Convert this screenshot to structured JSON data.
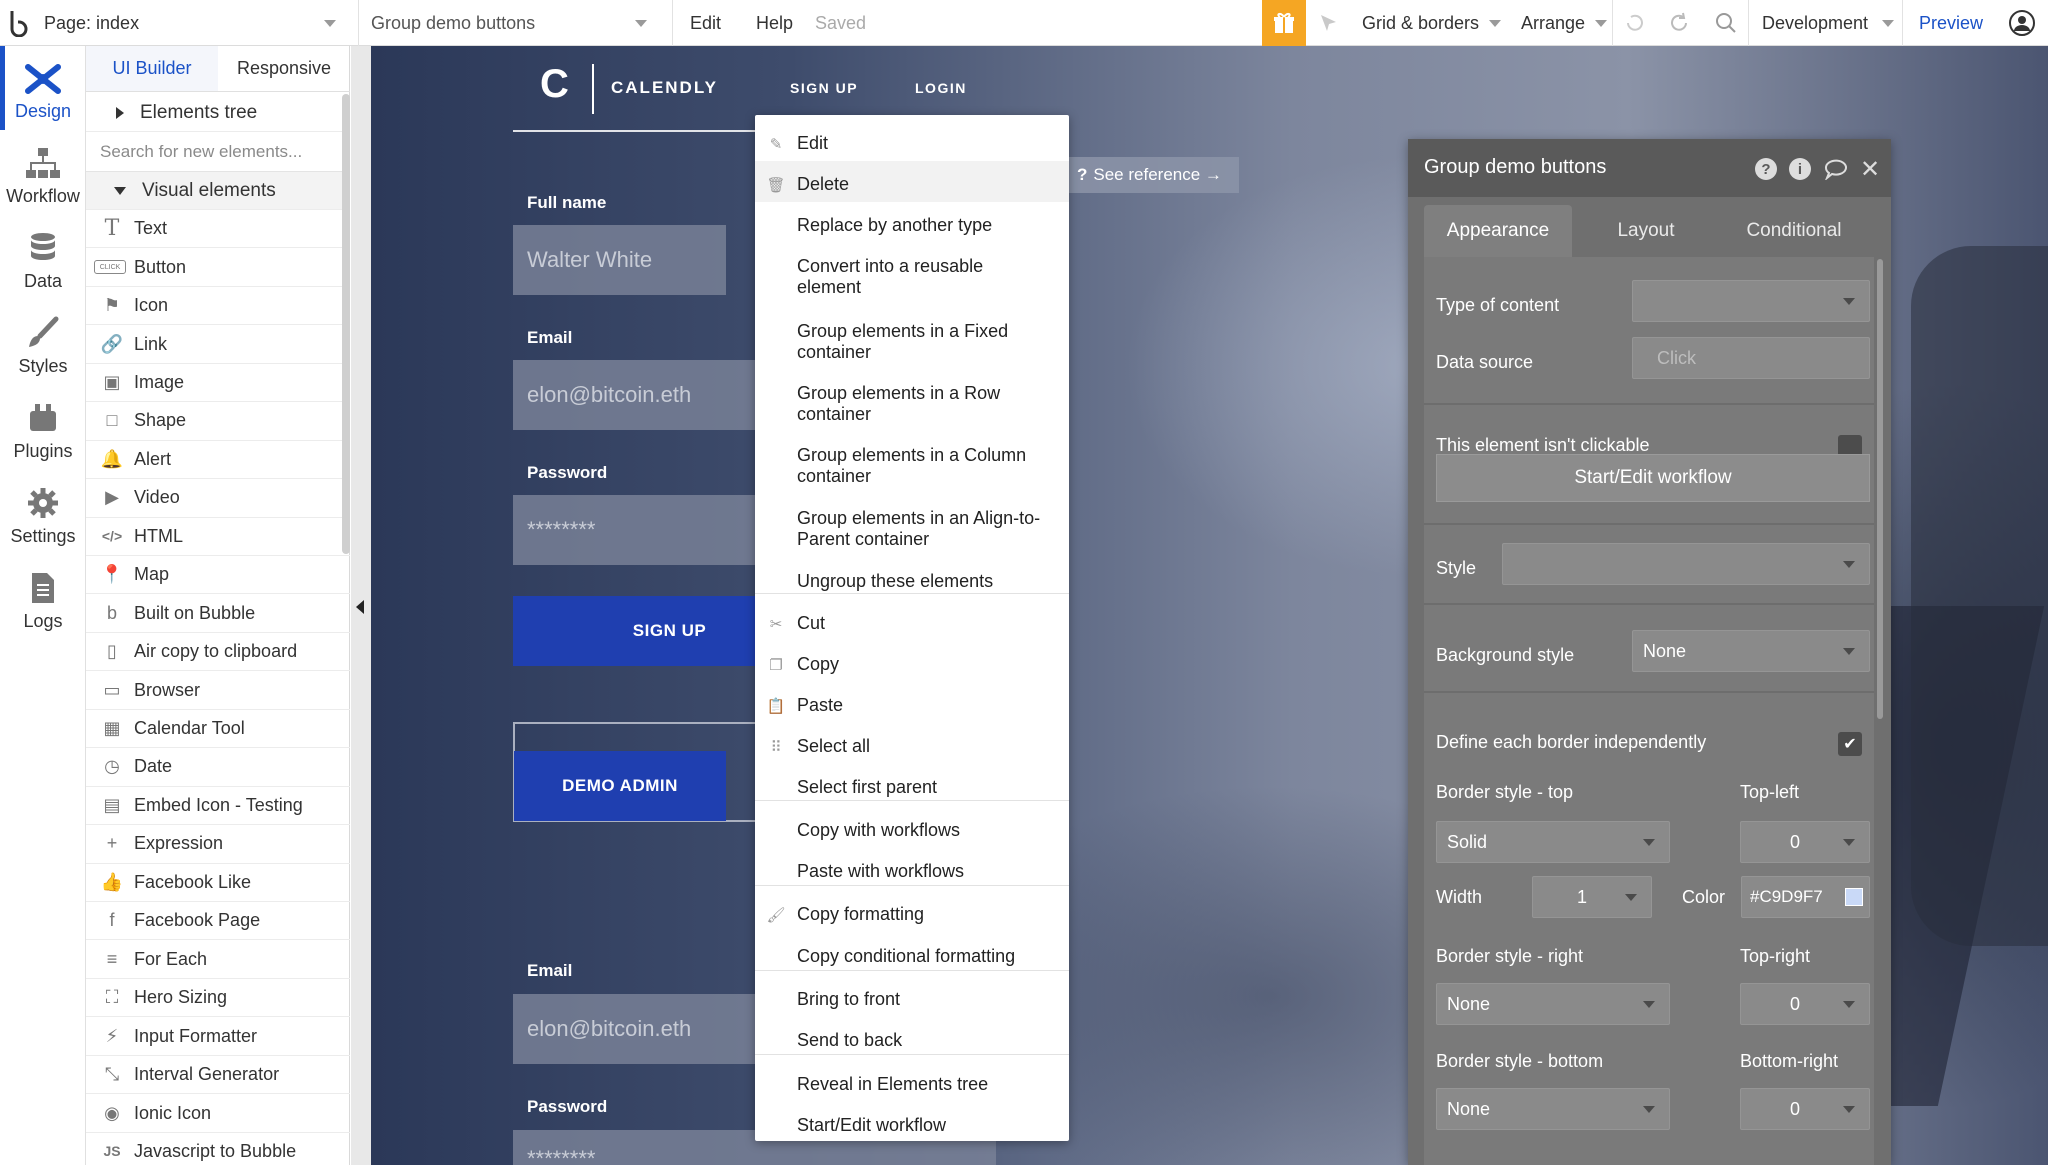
{
  "topbar": {
    "page_label": "Page: index",
    "element_selector": "Group demo buttons",
    "menu_edit": "Edit",
    "menu_help": "Help",
    "save_status": "Saved",
    "grid_label": "Grid & borders",
    "arrange_label": "Arrange",
    "env_label": "Development",
    "preview_label": "Preview"
  },
  "rail": {
    "items": [
      {
        "label": "Design",
        "icon": "design-icon"
      },
      {
        "label": "Workflow",
        "icon": "workflow-icon"
      },
      {
        "label": "Data",
        "icon": "database-icon"
      },
      {
        "label": "Styles",
        "icon": "brush-icon"
      },
      {
        "label": "Plugins",
        "icon": "plugin-icon"
      },
      {
        "label": "Settings",
        "icon": "gear-icon"
      },
      {
        "label": "Logs",
        "icon": "document-icon"
      }
    ]
  },
  "panel": {
    "tab_builder": "UI Builder",
    "tab_responsive": "Responsive",
    "elements_tree": "Elements tree",
    "search_placeholder": "Search for new elements...",
    "visual_elements": "Visual elements",
    "elements": [
      {
        "label": "Text",
        "icon": "T"
      },
      {
        "label": "Button",
        "icon": "CLICK"
      },
      {
        "label": "Icon",
        "icon": "⚑"
      },
      {
        "label": "Link",
        "icon": "🔗"
      },
      {
        "label": "Image",
        "icon": "▣"
      },
      {
        "label": "Shape",
        "icon": "□"
      },
      {
        "label": "Alert",
        "icon": "🔔"
      },
      {
        "label": "Video",
        "icon": "▶"
      },
      {
        "label": "HTML",
        "icon": "</>"
      },
      {
        "label": "Map",
        "icon": "📍"
      },
      {
        "label": "Built on Bubble",
        "icon": "b"
      },
      {
        "label": "Air copy to clipboard",
        "icon": "▯"
      },
      {
        "label": "Browser",
        "icon": "▭"
      },
      {
        "label": "Calendar Tool",
        "icon": "▦"
      },
      {
        "label": "Date",
        "icon": "◷"
      },
      {
        "label": "Embed Icon - Testing",
        "icon": "▤"
      },
      {
        "label": "Expression",
        "icon": "+"
      },
      {
        "label": "Facebook Like",
        "icon": "👍"
      },
      {
        "label": "Facebook Page",
        "icon": "f"
      },
      {
        "label": "For Each",
        "icon": "≡"
      },
      {
        "label": "Hero Sizing",
        "icon": "⛶"
      },
      {
        "label": "Input Formatter",
        "icon": "⚡"
      },
      {
        "label": "Interval Generator",
        "icon": "⤡"
      },
      {
        "label": "Ionic Icon",
        "icon": "◉"
      },
      {
        "label": "Javascript to Bubble",
        "icon": "JS"
      }
    ]
  },
  "canvas": {
    "brand_letter": "C",
    "brand_name": "CALENDLY",
    "nav_signup": "SIGN UP",
    "nav_login": "LOGIN",
    "label_fullname": "Full name",
    "value_fullname": "Walter White",
    "label_email": "Email",
    "value_email": "elon@bitcoin.eth",
    "label_password": "Password",
    "value_password": "********",
    "btn_signup": "SIGN UP",
    "btn_demo_admin": "DEMO ADMIN",
    "label_email2": "Email",
    "value_email2": "elon@bitcoin.eth",
    "label_password2": "Password",
    "value_password2": "********"
  },
  "context_menu": {
    "see_reference": "See reference →",
    "items": [
      {
        "label": "Edit",
        "icon": "✎"
      },
      {
        "label": "Delete",
        "icon": "🗑"
      },
      {
        "label": "Replace by another type",
        "icon": ""
      },
      {
        "label": "Convert into a reusable element",
        "icon": ""
      },
      {
        "label": "Group elements in a Fixed container",
        "icon": ""
      },
      {
        "label": "Group elements in a Row container",
        "icon": ""
      },
      {
        "label": "Group elements in a Column container",
        "icon": ""
      },
      {
        "label": "Group elements in an Align-to-Parent container",
        "icon": ""
      },
      {
        "label": "Ungroup these elements",
        "icon": ""
      },
      {
        "label": "Cut",
        "icon": "✂"
      },
      {
        "label": "Copy",
        "icon": "❐"
      },
      {
        "label": "Paste",
        "icon": "📋"
      },
      {
        "label": "Select all",
        "icon": "⠿"
      },
      {
        "label": "Select first parent",
        "icon": ""
      },
      {
        "label": "Copy with workflows",
        "icon": ""
      },
      {
        "label": "Paste with workflows",
        "icon": ""
      },
      {
        "label": "Copy formatting",
        "icon": "🖌"
      },
      {
        "label": "Copy conditional formatting",
        "icon": ""
      },
      {
        "label": "Bring to front",
        "icon": ""
      },
      {
        "label": "Send to back",
        "icon": ""
      },
      {
        "label": "Reveal in Elements tree",
        "icon": ""
      },
      {
        "label": "Start/Edit workflow",
        "icon": ""
      }
    ]
  },
  "props": {
    "title": "Group demo buttons",
    "tab_appearance": "Appearance",
    "tab_layout": "Layout",
    "tab_conditional": "Conditional",
    "type_of_content": "Type of content",
    "data_source": "Data source",
    "data_source_value": "Click",
    "not_clickable": "This element isn't clickable",
    "start_workflow": "Start/Edit workflow",
    "style": "Style",
    "background_style": "Background style",
    "background_value": "None",
    "define_each_border": "Define each border independently",
    "border_top": "Border style - top",
    "border_top_value": "Solid",
    "top_left": "Top-left",
    "top_left_value": "0",
    "width": "Width",
    "width_value": "1",
    "color": "Color",
    "color_value": "#C9D9F7",
    "border_right": "Border style - right",
    "border_right_value": "None",
    "top_right": "Top-right",
    "top_right_value": "0",
    "border_bottom": "Border style - bottom",
    "border_bottom_value": "None",
    "bottom_right": "Bottom-right",
    "bottom_right_value": "0",
    "border_color_swatch": "#C9D9F7"
  }
}
